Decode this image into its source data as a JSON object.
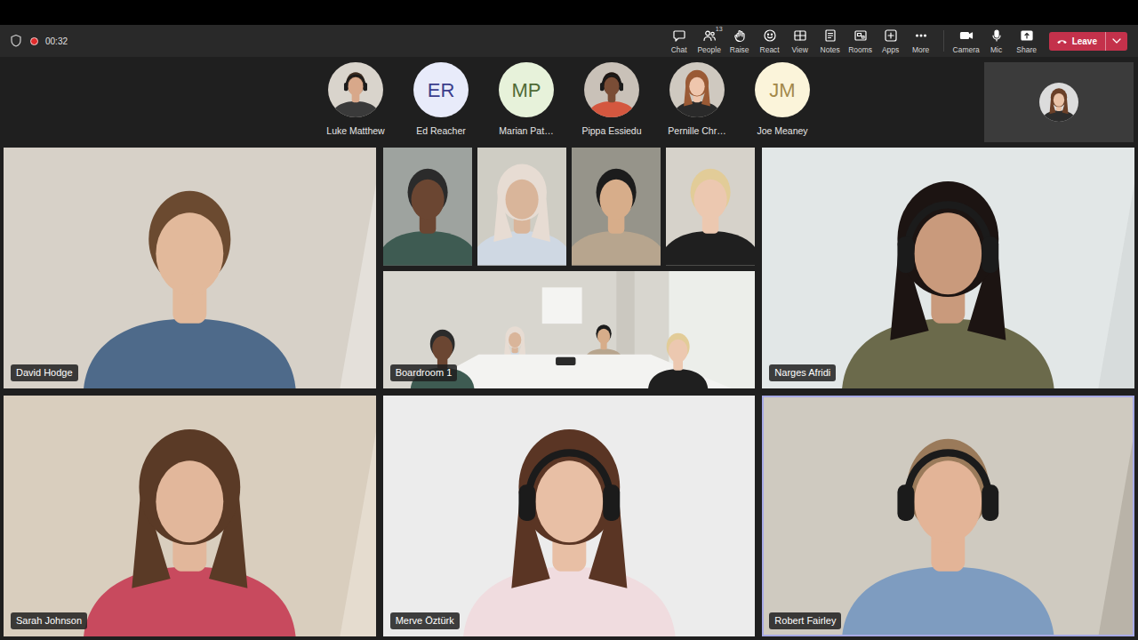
{
  "meeting": {
    "recording": true,
    "timer": "00:32"
  },
  "toolbar": {
    "items": [
      {
        "label": "Chat"
      },
      {
        "label": "People",
        "badge": "13"
      },
      {
        "label": "Raise"
      },
      {
        "label": "React"
      },
      {
        "label": "View"
      },
      {
        "label": "Notes"
      },
      {
        "label": "Rooms"
      },
      {
        "label": "Apps"
      },
      {
        "label": "More"
      }
    ],
    "devices": [
      {
        "label": "Camera"
      },
      {
        "label": "Mic"
      },
      {
        "label": "Share"
      }
    ],
    "leave": {
      "label": "Leave"
    }
  },
  "participants": [
    {
      "name": "Luke Matthew",
      "kind": "photo"
    },
    {
      "name": "Ed Reacher",
      "kind": "initials",
      "initials": "ER",
      "color": "#e8ebfa",
      "initials_color": "#3b3d8c"
    },
    {
      "name": "Marian Pat…",
      "kind": "initials",
      "initials": "MP",
      "color": "#e7f2da",
      "initials_color": "#4f6b35"
    },
    {
      "name": "Pippa Essiedu",
      "kind": "photo"
    },
    {
      "name": "Pernille Chr…",
      "kind": "photo"
    },
    {
      "name": "Joe Meaney",
      "kind": "initials",
      "initials": "JM",
      "color": "#fbf4da",
      "initials_color": "#a3884a"
    }
  ],
  "tiles": [
    {
      "name": "David Hodge",
      "kind": "person",
      "speaking": false
    },
    {
      "name": "Boardroom 1",
      "kind": "room",
      "speaking": false
    },
    {
      "name": "Narges Afridi",
      "kind": "person",
      "speaking": false
    },
    {
      "name": "Sarah Johnson",
      "kind": "person",
      "speaking": false
    },
    {
      "name": "Merve Öztürk",
      "kind": "person",
      "speaking": false
    },
    {
      "name": "Robert Fairley",
      "kind": "person",
      "speaking": true
    }
  ]
}
